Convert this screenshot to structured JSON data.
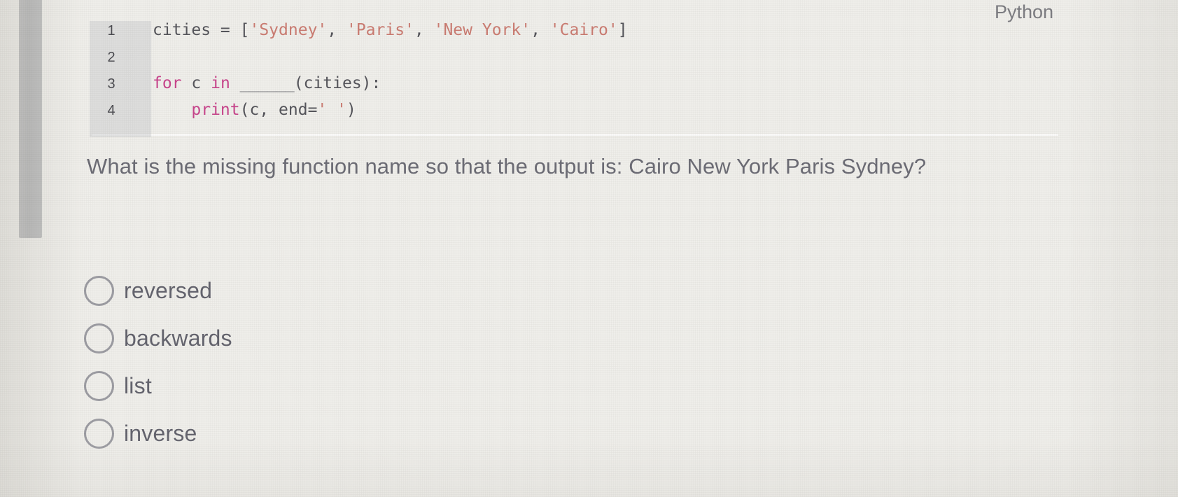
{
  "code_block": {
    "language_label": "Python",
    "lines": [
      {
        "number": "1",
        "tokens": [
          {
            "text": "cities = [",
            "type": "plain"
          },
          {
            "text": "'Sydney'",
            "type": "string"
          },
          {
            "text": ", ",
            "type": "plain"
          },
          {
            "text": "'Paris'",
            "type": "string"
          },
          {
            "text": ", ",
            "type": "plain"
          },
          {
            "text": "'New York'",
            "type": "string"
          },
          {
            "text": ", ",
            "type": "plain"
          },
          {
            "text": "'Cairo'",
            "type": "string"
          },
          {
            "text": "]",
            "type": "plain"
          }
        ]
      },
      {
        "number": "2",
        "tokens": []
      },
      {
        "number": "3",
        "tokens": [
          {
            "text": "for",
            "type": "keyword"
          },
          {
            "text": " c ",
            "type": "plain"
          },
          {
            "text": "in",
            "type": "keyword"
          },
          {
            "text": " ",
            "type": "plain"
          },
          {
            "text": "______",
            "type": "blank"
          },
          {
            "text": "(cities):",
            "type": "plain"
          }
        ]
      },
      {
        "number": "4",
        "tokens": [
          {
            "text": "    ",
            "type": "plain"
          },
          {
            "text": "print",
            "type": "function"
          },
          {
            "text": "(c, end=",
            "type": "plain"
          },
          {
            "text": "' '",
            "type": "string"
          },
          {
            "text": ")",
            "type": "plain"
          }
        ]
      }
    ]
  },
  "question": {
    "text": "What is the missing function name so that the output is: Cairo New York Paris Sydney?"
  },
  "options": [
    {
      "id": "opt-reversed",
      "label": "reversed",
      "selected": false
    },
    {
      "id": "opt-backwards",
      "label": "backwards",
      "selected": false
    },
    {
      "id": "opt-list",
      "label": "list",
      "selected": false
    },
    {
      "id": "opt-inverse",
      "label": "inverse",
      "selected": false
    }
  ],
  "colors": {
    "background": "#efeeea",
    "keyword": "#c8458c",
    "string": "#cb7c72",
    "code_plain": "#55555b",
    "question_text": "#6c6c75",
    "option_text": "#64646e",
    "radio_border": "#9c9ca2",
    "gutter_background": "#c4c5c7",
    "scrollbar": "#a9aaac"
  }
}
